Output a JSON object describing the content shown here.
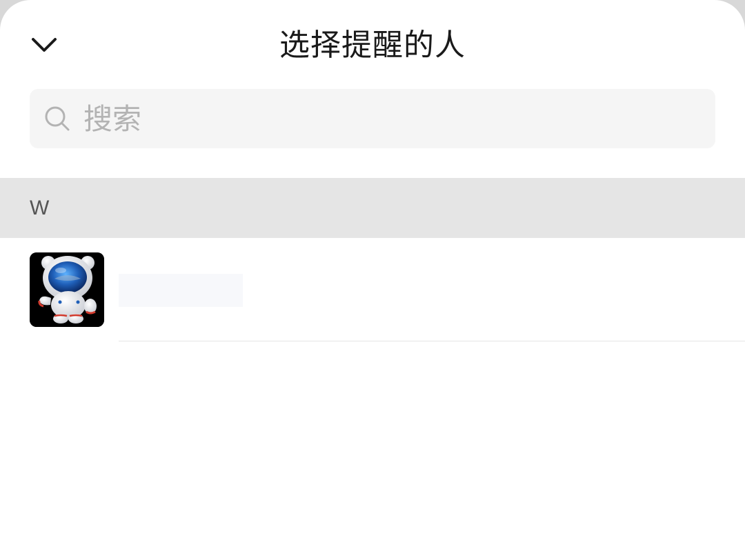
{
  "header": {
    "title": "选择提醒的人",
    "back_icon": "chevron-down-icon"
  },
  "search": {
    "placeholder": "搜索",
    "value": "",
    "icon": "search-icon"
  },
  "sections": [
    {
      "letter": "W",
      "contacts": [
        {
          "name": "",
          "avatar": "astronaut-avatar"
        }
      ]
    }
  ],
  "colors": {
    "background": "#ffffff",
    "search_bg": "#f5f5f5",
    "section_bg": "#e5e5e5",
    "title_text": "#1a1a1a",
    "placeholder_text": "#b3b3b3"
  }
}
